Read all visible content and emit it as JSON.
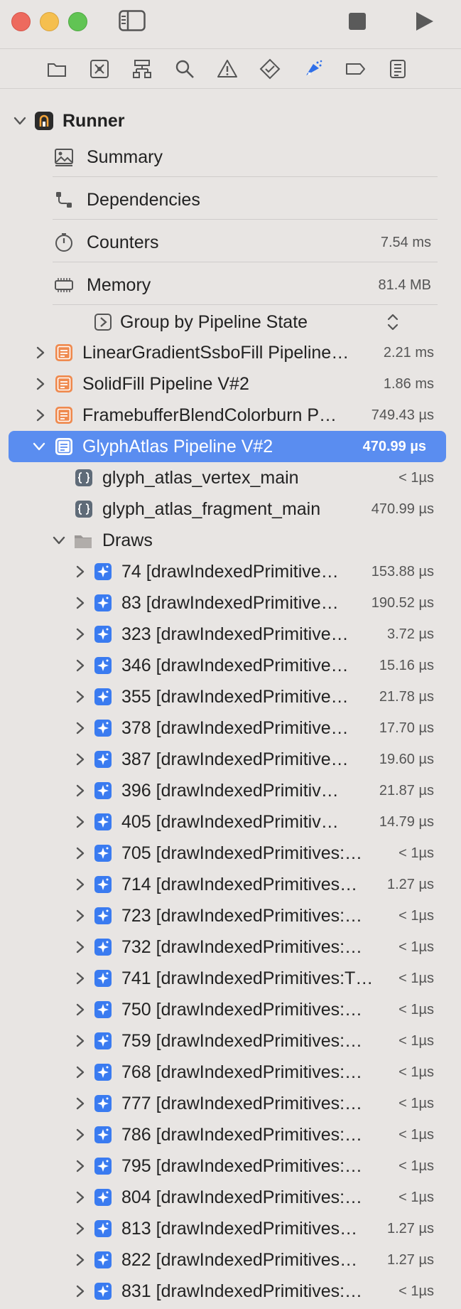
{
  "window": {
    "toolbar_icons": [
      "sidebar-toggle-icon",
      "stop-icon",
      "run-icon"
    ],
    "navigator_icons": [
      "folder-icon",
      "source-control-icon",
      "hierarchy-icon",
      "search-icon",
      "warning-icon",
      "test-icon",
      "debug-icon",
      "breakpoint-icon",
      "report-icon"
    ]
  },
  "tree": {
    "root": {
      "label": "Runner"
    },
    "top_items": [
      {
        "label": "Summary",
        "value": ""
      },
      {
        "label": "Dependencies",
        "value": ""
      },
      {
        "label": "Counters",
        "value": "7.54 ms"
      },
      {
        "label": "Memory",
        "value": "81.4 MB"
      }
    ],
    "group_by": {
      "label": "Group by Pipeline State"
    },
    "pipelines": [
      {
        "label": "LinearGradientSsboFill Pipeline…",
        "value": "2.21 ms"
      },
      {
        "label": "SolidFill Pipeline V#2",
        "value": "1.86 ms"
      },
      {
        "label": "FramebufferBlendColorburn P…",
        "value": "749.43 µs"
      },
      {
        "label": "GlyphAtlas Pipeline V#2",
        "value": "470.99 µs"
      }
    ],
    "shaders": [
      {
        "label": "glyph_atlas_vertex_main",
        "value": "< 1µs"
      },
      {
        "label": "glyph_atlas_fragment_main",
        "value": "470.99 µs"
      }
    ],
    "draws_label": "Draws",
    "draws": [
      {
        "label": "74 [drawIndexedPrimitive…",
        "value": "153.88 µs"
      },
      {
        "label": "83 [drawIndexedPrimitive…",
        "value": "190.52 µs"
      },
      {
        "label": "323 [drawIndexedPrimitive…",
        "value": "3.72 µs"
      },
      {
        "label": "346 [drawIndexedPrimitive…",
        "value": "15.16 µs"
      },
      {
        "label": "355 [drawIndexedPrimitive…",
        "value": "21.78 µs"
      },
      {
        "label": "378 [drawIndexedPrimitive…",
        "value": "17.70 µs"
      },
      {
        "label": "387 [drawIndexedPrimitive…",
        "value": "19.60 µs"
      },
      {
        "label": "396 [drawIndexedPrimitiv…",
        "value": "21.87 µs"
      },
      {
        "label": "405 [drawIndexedPrimitiv…",
        "value": "14.79 µs"
      },
      {
        "label": "705 [drawIndexedPrimitives:…",
        "value": "< 1µs"
      },
      {
        "label": "714 [drawIndexedPrimitives…",
        "value": "1.27 µs"
      },
      {
        "label": "723 [drawIndexedPrimitives:…",
        "value": "< 1µs"
      },
      {
        "label": "732 [drawIndexedPrimitives:…",
        "value": "< 1µs"
      },
      {
        "label": "741 [drawIndexedPrimitives:T…",
        "value": "< 1µs"
      },
      {
        "label": "750 [drawIndexedPrimitives:…",
        "value": "< 1µs"
      },
      {
        "label": "759 [drawIndexedPrimitives:…",
        "value": "< 1µs"
      },
      {
        "label": "768 [drawIndexedPrimitives:…",
        "value": "< 1µs"
      },
      {
        "label": "777 [drawIndexedPrimitives:…",
        "value": "< 1µs"
      },
      {
        "label": "786 [drawIndexedPrimitives:…",
        "value": "< 1µs"
      },
      {
        "label": "795 [drawIndexedPrimitives:…",
        "value": "< 1µs"
      },
      {
        "label": "804 [drawIndexedPrimitives:…",
        "value": "< 1µs"
      },
      {
        "label": "813 [drawIndexedPrimitives…",
        "value": "1.27 µs"
      },
      {
        "label": "822 [drawIndexedPrimitives…",
        "value": "1.27 µs"
      },
      {
        "label": "831 [drawIndexedPrimitives:…",
        "value": "< 1µs"
      }
    ]
  },
  "colors": {
    "selection": "#5a8df0",
    "pipeline_icon": "#ef8a4f",
    "draw_icon": "#3a7bf0",
    "shader_icon": "#5f6b78"
  }
}
